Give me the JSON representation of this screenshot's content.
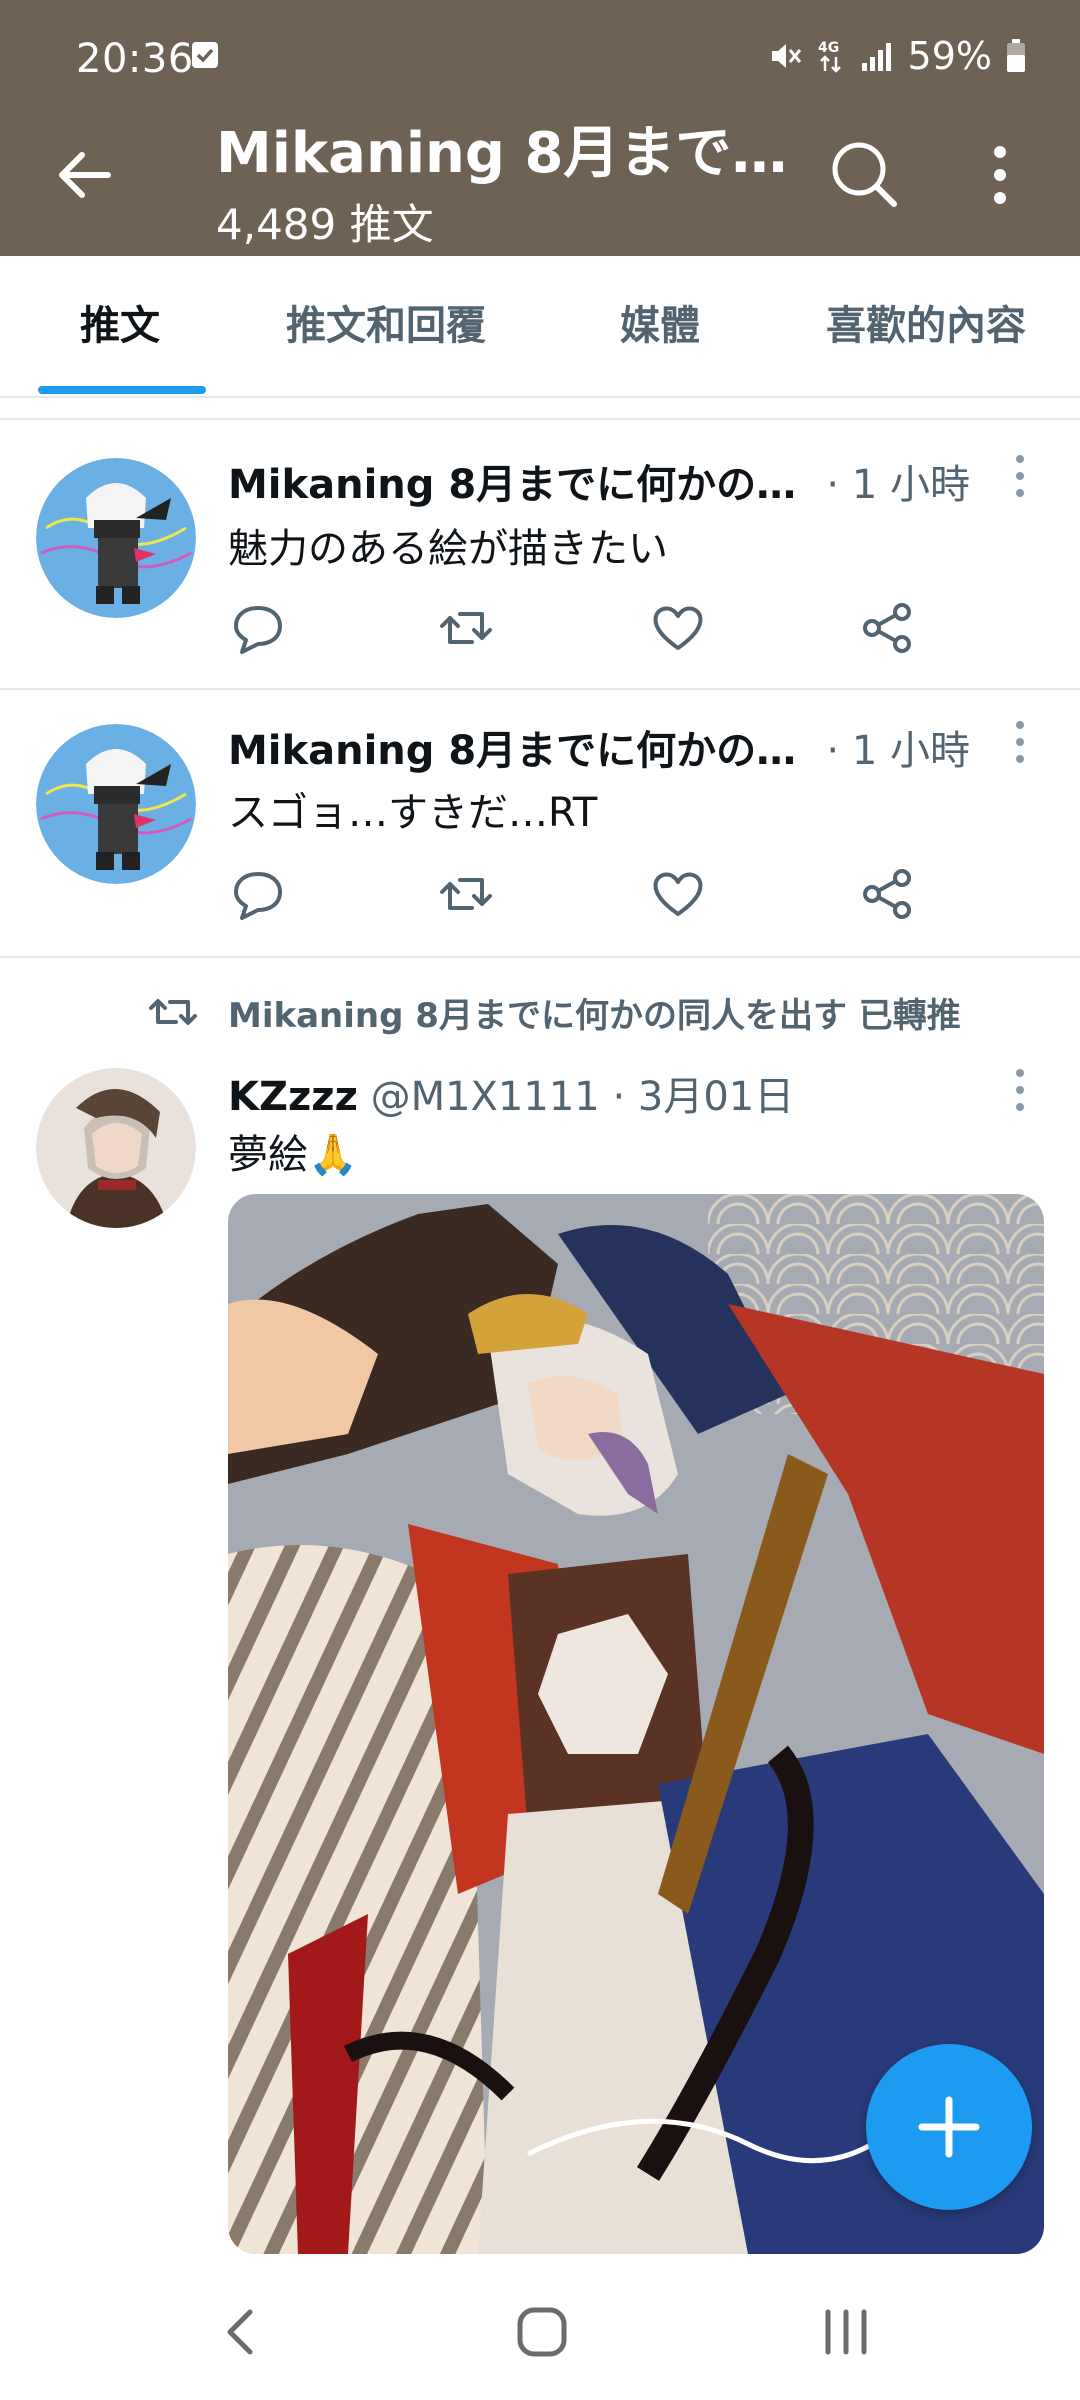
{
  "status_bar": {
    "time": "20:36",
    "battery": "59%",
    "icons": [
      "mute-icon",
      "4g-icon",
      "signal-icon",
      "battery-icon"
    ]
  },
  "header": {
    "title": "Mikaning 8月まで…",
    "subtitle": "4,489 推文"
  },
  "tabs": [
    {
      "label": "推文",
      "active": true
    },
    {
      "label": "推文和回覆",
      "active": false
    },
    {
      "label": "媒體",
      "active": false
    },
    {
      "label": "喜歡的內容",
      "active": false
    }
  ],
  "tweets": [
    {
      "name": "Mikaning 8月までに何かの…",
      "time": "· 1 小時",
      "text": "魅力のある絵が描きたい"
    },
    {
      "name": "Mikaning 8月までに何かの…",
      "time": "· 1 小時",
      "text": "スゴョ…すきだ…RT"
    },
    {
      "retweet_label": "Mikaning 8月までに何かの同人を出す 已轉推",
      "name": "KZzzz",
      "handle": "@M1X1111 · 3月01日",
      "text": "夢絵🙏"
    }
  ],
  "colors": {
    "header_bg": "#6d6254",
    "accent": "#1d9bf0",
    "text_secondary": "#536471"
  }
}
